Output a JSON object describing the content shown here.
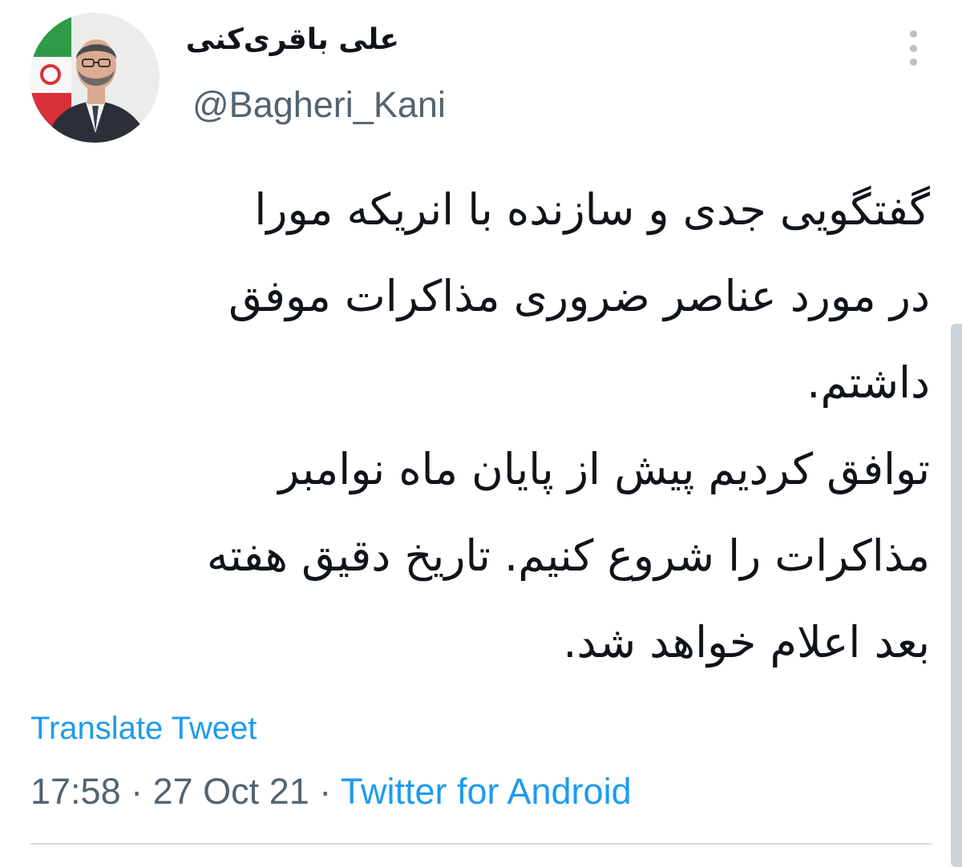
{
  "user": {
    "display_name": "علی باقری‌کنی",
    "handle": "@Bagheri_Kani"
  },
  "tweet": {
    "lines": [
      "گفتگویی جدی و سازنده با انریکه مورا",
      "در مورد عناصر ضروری مذاکرات موفق",
      "داشتم.",
      "توافق کردیم پیش از پایان ماه نوامبر",
      "مذاکرات را شروع کنیم. تاریخ دقیق هفته",
      "بعد اعلام خواهد شد."
    ],
    "translate_label": "Translate Tweet",
    "time": "17:58",
    "date": "27 Oct 21",
    "separator": " · ",
    "source": "Twitter for Android"
  },
  "icons": {
    "more": "more-vertical-icon"
  },
  "colors": {
    "link": "#1d9bf0",
    "secondary_text": "#536471",
    "primary_text": "#0f1419",
    "divider": "#d7dde2"
  }
}
